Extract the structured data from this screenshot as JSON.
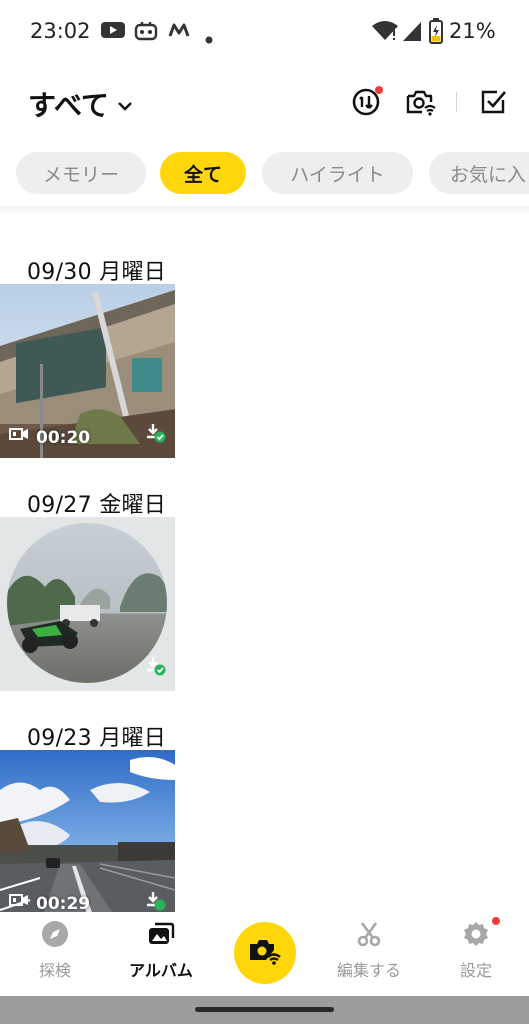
{
  "status_bar": {
    "time": "23:02",
    "battery": "21%",
    "icons": [
      "youtube-icon",
      "game-controller-icon",
      "m-app-icon",
      "notification-dot-icon",
      "wifi-icon",
      "cell-signal-icon",
      "battery-charging-icon"
    ]
  },
  "header": {
    "title": "すべて",
    "icons": [
      "sync-badge-icon",
      "camera-wifi-icon",
      "select-checkbox-icon"
    ]
  },
  "filters": [
    {
      "label": "メモリー",
      "active": false
    },
    {
      "label": "全て",
      "active": true
    },
    {
      "label": "ハイライト",
      "active": false
    },
    {
      "label": "お気に入",
      "active": false
    }
  ],
  "sections": [
    {
      "date": "09/30  月曜日",
      "duration": "00:20",
      "kind": "video"
    },
    {
      "date": "09/27  金曜日",
      "duration": "",
      "kind": "photo-360"
    },
    {
      "date": "09/23  月曜日",
      "duration": "00:29",
      "kind": "video"
    }
  ],
  "bottom_nav": [
    {
      "label": "探検",
      "icon": "compass-icon",
      "active": false
    },
    {
      "label": "アルバム",
      "icon": "album-icon",
      "active": true
    },
    {
      "label": "",
      "icon": "camera-connect-icon",
      "active": false
    },
    {
      "label": "編集する",
      "icon": "scissors-icon",
      "active": false
    },
    {
      "label": "設定",
      "icon": "gear-icon",
      "active": false
    }
  ],
  "colors": {
    "accent": "#ffd60a",
    "notification": "#f23b3b",
    "chip_bg": "#eeeeee",
    "inactive_text": "#9a9a9a"
  }
}
